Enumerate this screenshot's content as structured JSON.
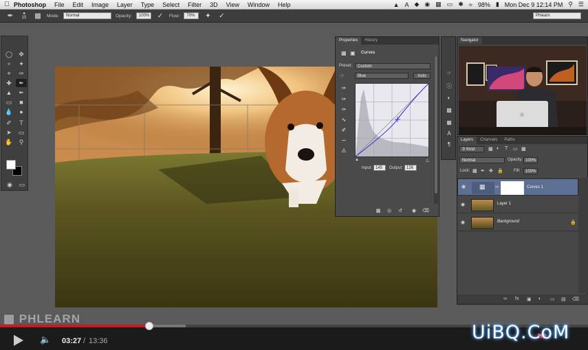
{
  "menubar": {
    "apple": "",
    "app": "Photoshop",
    "items": [
      "File",
      "Edit",
      "Image",
      "Layer",
      "Type",
      "Select",
      "Filter",
      "3D",
      "View",
      "Window",
      "Help"
    ],
    "battery": "98%",
    "clock": "Mon Dec 9  12:14 PM"
  },
  "options": {
    "brush_size": "15",
    "mode_label": "Mode:",
    "mode_value": "Normal",
    "opacity_label": "Opacity:",
    "opacity_value": "100%",
    "flow_label": "Flow:",
    "flow_value": "70%",
    "workspace": "Phlearn"
  },
  "properties": {
    "tabs": [
      "Properties",
      "History"
    ],
    "title": "Curves",
    "preset_label": "Preset:",
    "preset_value": "Custom",
    "channel_value": "Blue",
    "auto_label": "Auto",
    "input_label": "Input:",
    "input_value": "145",
    "output_label": "Output:",
    "output_value": "126"
  },
  "navigator": {
    "tab": "Navigator"
  },
  "layers": {
    "tabs": [
      "Layers",
      "Channels",
      "Paths"
    ],
    "filter_value": "Kind",
    "blend_value": "Normal",
    "opacity_label": "Opacity:",
    "opacity_value": "100%",
    "lock_label": "Lock:",
    "fill_label": "Fill:",
    "fill_value": "100%",
    "items": [
      {
        "name": "Curves 1",
        "selected": true
      },
      {
        "name": "Layer 1",
        "selected": false
      },
      {
        "name": "Background",
        "selected": false
      }
    ]
  },
  "player": {
    "current_time": "03:27",
    "separator": "/",
    "total_time": "13:36",
    "played_fraction": 0.254
  },
  "watermarks": {
    "phlearn": "PHLEARN",
    "uibq": "UiBQ.CoM"
  },
  "colors": {
    "accent_red": "#cc181e",
    "selected_layer": "#5d6f92",
    "panel_bg": "#4a4a4a",
    "workspace_bg": "#5a5a5a"
  }
}
